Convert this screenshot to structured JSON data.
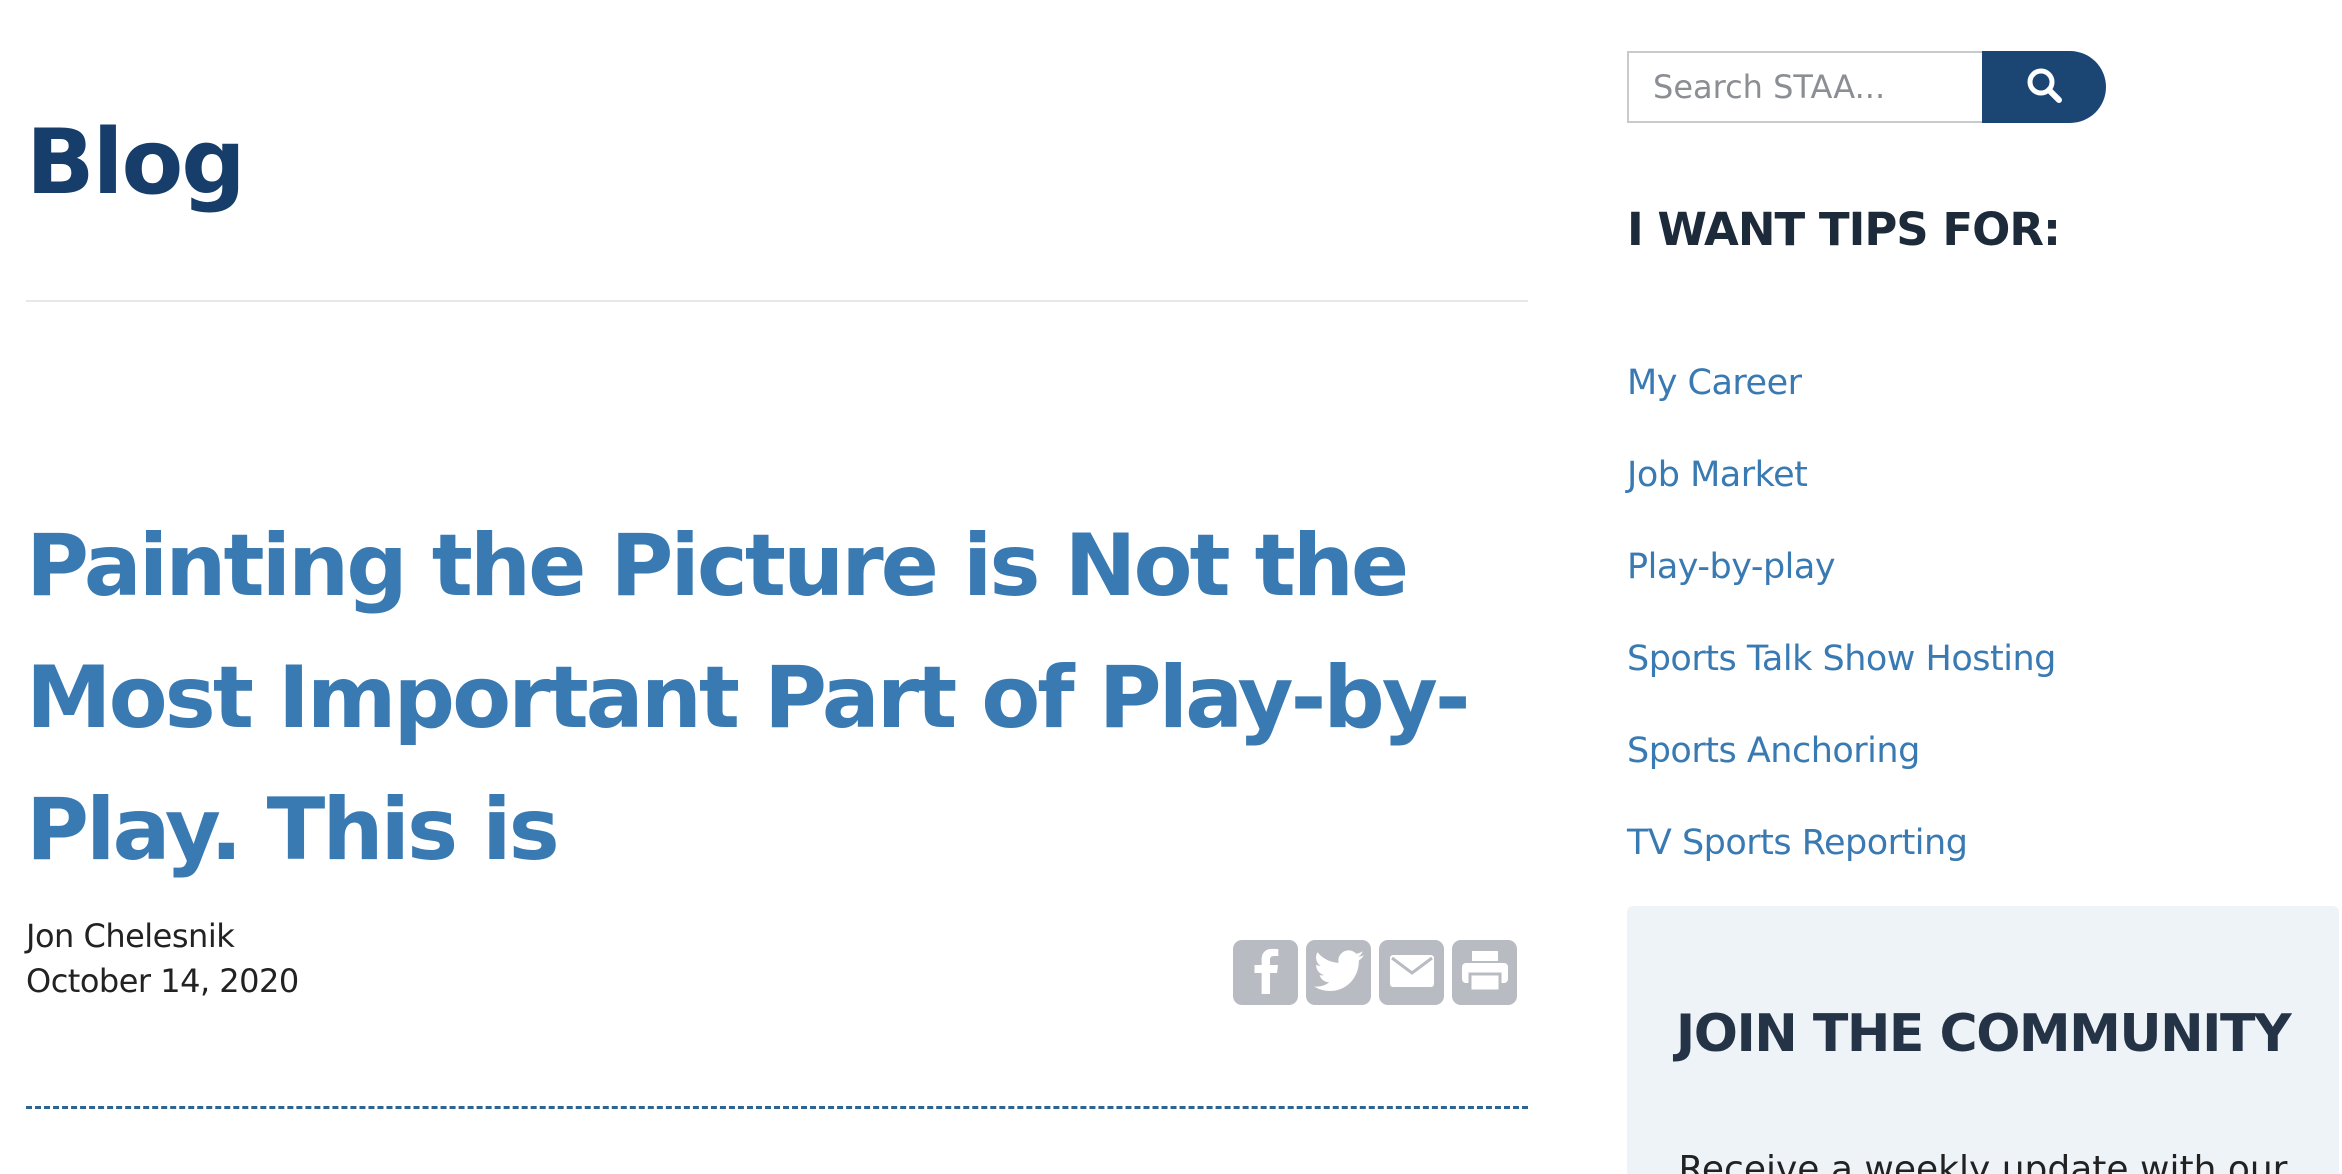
{
  "main": {
    "heading": "Blog",
    "post": {
      "title": "Painting the Picture is Not the Most Important Part of Play-by-Play. This is",
      "author": "Jon Chelesnik",
      "date": "October 14, 2020"
    },
    "share_buttons": [
      {
        "name": "facebook-icon"
      },
      {
        "name": "twitter-icon"
      },
      {
        "name": "email-icon"
      },
      {
        "name": "print-icon"
      }
    ]
  },
  "sidebar": {
    "search": {
      "placeholder": "Search STAA...",
      "icon": "search-icon"
    },
    "tips_heading": "I WANT TIPS FOR:",
    "tips": [
      {
        "label": "My Career"
      },
      {
        "label": "Job Market"
      },
      {
        "label": "Play-by-play"
      },
      {
        "label": "Sports Talk Show Hosting"
      },
      {
        "label": "Sports Anchoring"
      },
      {
        "label": "TV Sports Reporting"
      }
    ],
    "community": {
      "title": "JOIN THE COMMUNITY",
      "text": "Receive a weekly update with our"
    }
  },
  "colors": {
    "heading_navy": "#173e6b",
    "link_blue": "#3a7ab3",
    "search_button": "#1b4674",
    "share_grey": "#b8bcc2",
    "community_bg": "#eef3f7"
  }
}
